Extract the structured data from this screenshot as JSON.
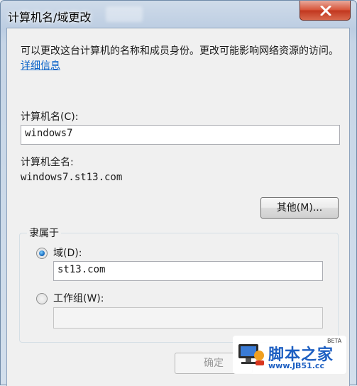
{
  "window": {
    "title": "计算机名/域更改"
  },
  "description": {
    "text": "可以更改这台计算机的名称和成员身份。更改可能影响网络资源的访问。",
    "link": "详细信息"
  },
  "computer_name": {
    "label": "计算机名(C):",
    "value": "windows7"
  },
  "full_name": {
    "label": "计算机全名:",
    "value": "windows7.st13.com"
  },
  "more_button": {
    "label": "其他(M)..."
  },
  "member_of": {
    "title": "隶属于",
    "domain": {
      "label": "域(D):",
      "value": "st13.com",
      "selected": true
    },
    "workgroup": {
      "label": "工作组(W):",
      "value": "",
      "selected": false
    }
  },
  "ok_button": {
    "label": "确定",
    "enabled": false
  },
  "watermark": {
    "brand": "脚本之家",
    "url": "www.JB51.cc",
    "badge": "BETA"
  },
  "colors": {
    "link": "#0a63c9",
    "close_button": "#c1371f",
    "radio_selected": "#1b6ec2",
    "watermark_brand": "#1d5fc2"
  },
  "icons": {
    "close": "close-icon",
    "watermark": "computer-logo-icon"
  }
}
